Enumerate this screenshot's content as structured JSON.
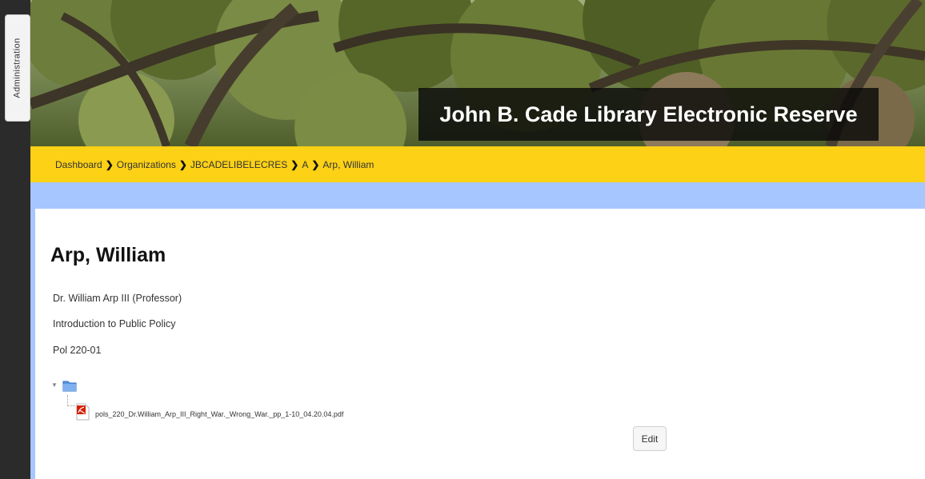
{
  "admin": {
    "tab_label": "Administration"
  },
  "header": {
    "title": "John B. Cade Library Electronic Reserve"
  },
  "breadcrumb": {
    "items": [
      {
        "label": "Dashboard"
      },
      {
        "label": "Organizations"
      },
      {
        "label": "JBCADELIBELECRES"
      },
      {
        "label": "A"
      },
      {
        "label": "Arp, William"
      }
    ]
  },
  "main": {
    "title": "Arp, William",
    "instructor": "Dr. William Arp III (Professor)",
    "course_name": "Introduction to Public Policy",
    "course_code": "Pol 220-01",
    "file": {
      "name": "pols_220_Dr.William_Arp_III_Right_War._Wrong_War._pp_1-10_04.20.04.pdf"
    },
    "edit_label": "Edit"
  },
  "icons": {
    "folder": "folder-icon",
    "pdf": "pdf-icon",
    "breadcrumb_separator": "chevron-right-icon",
    "tree_toggle": "caret-down-icon"
  },
  "colors": {
    "breadcrumb_bar": "#fcd116",
    "accent_blue": "#a6c6ff",
    "admin_rail": "#2b2b2b",
    "title_box": "#0a0a0a"
  }
}
